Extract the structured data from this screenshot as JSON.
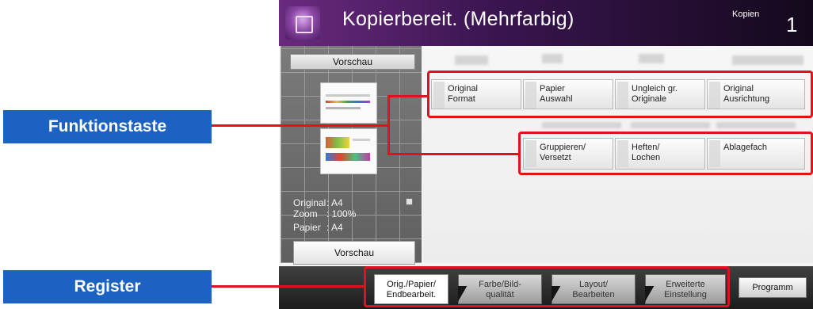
{
  "header": {
    "title": "Kopierbereit. (Mehrfarbig)",
    "copies_label": "Kopien",
    "copies_value": "1"
  },
  "preview": {
    "title_button": "Vorschau",
    "info": [
      {
        "key": "Original",
        "value": ": A4"
      },
      {
        "key": "Zoom",
        "value": ": 100%"
      },
      {
        "key": "Papier",
        "value": ": A4"
      }
    ],
    "button_label": "Vorschau"
  },
  "function_keys": {
    "row1": [
      {
        "label": "Original\nFormat"
      },
      {
        "label": "Papier\nAuswahl"
      },
      {
        "label": "Ungleich gr.\nOriginale"
      },
      {
        "label": "Original\nAusrichtung"
      }
    ],
    "row2": [
      {
        "label": "Gruppieren/\nVersetzt"
      },
      {
        "label": "Heften/\nLochen"
      },
      {
        "label": "Ablagefach"
      }
    ]
  },
  "tabs": [
    {
      "label": "Orig./Papier/\nEndbearbeit.",
      "active": true
    },
    {
      "label": "Farbe/Bild-\nqualität",
      "active": false
    },
    {
      "label": "Layout/\nBearbeiten",
      "active": false
    },
    {
      "label": "Erweiterte\nEinstellung",
      "active": false
    }
  ],
  "program_button": "Programm",
  "callouts": {
    "function_key": "Funktionstaste",
    "register": "Register"
  },
  "colors": {
    "highlight": "#e3111b",
    "callout_bg": "#1b62c2",
    "header_accent": "#6a2a7e"
  },
  "icons": [
    "copy-app-icon"
  ]
}
